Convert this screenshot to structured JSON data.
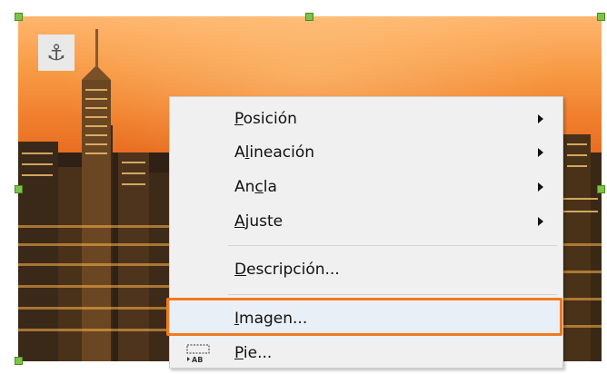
{
  "image": {
    "anchor_icon": "anchor-icon",
    "anchor_glyph": "⚓",
    "accent_color": "#ef7a22",
    "handle_color": "#7fc24a"
  },
  "context_menu": {
    "items": [
      {
        "prefix": "",
        "accel": "P",
        "suffix": "osición",
        "has_submenu": true
      },
      {
        "prefix": "A",
        "accel": "l",
        "suffix": "ineación",
        "has_submenu": true
      },
      {
        "prefix": "An",
        "accel": "c",
        "suffix": "la",
        "has_submenu": true
      },
      {
        "prefix": "",
        "accel": "A",
        "suffix": "juste",
        "has_submenu": true
      },
      {
        "prefix": "",
        "accel": "D",
        "suffix": "escripción...",
        "has_submenu": false
      },
      {
        "prefix": "",
        "accel": "I",
        "suffix": "magen...",
        "has_submenu": false,
        "highlighted": true
      },
      {
        "prefix": "",
        "accel": "P",
        "suffix": "ie...",
        "has_submenu": false,
        "icon": "insert-caption-icon",
        "icon_text": "AB"
      }
    ]
  }
}
